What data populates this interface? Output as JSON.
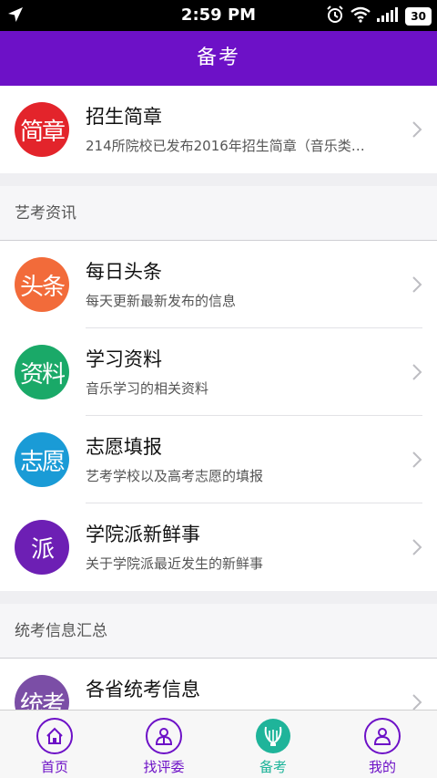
{
  "status_bar": {
    "time": "2:59 PM",
    "battery": "30",
    "icons": [
      "location-arrow-icon",
      "alarm-icon",
      "wifi-icon",
      "signal-icon",
      "battery-icon"
    ]
  },
  "nav": {
    "title": "备考"
  },
  "featured": {
    "title": "招生简章",
    "subtitle": "214所院校已发布2016年招生简章（音乐类…",
    "icon_text": "简章",
    "icon_color": "#e3242b"
  },
  "sections": [
    {
      "header": "艺考资讯",
      "items": [
        {
          "title": "每日头条",
          "subtitle": "每天更新最新发布的信息",
          "icon_text": "头条",
          "icon_color": "#f26b3a"
        },
        {
          "title": "学习资料",
          "subtitle": "音乐学习的相关资料",
          "icon_text": "资料",
          "icon_color": "#1aa968"
        },
        {
          "title": "志愿填报",
          "subtitle": "艺考学校以及高考志愿的填报",
          "icon_text": "志愿",
          "icon_color": "#1a9bd6"
        },
        {
          "title": "学院派新鲜事",
          "subtitle": "关于学院派最近发生的新鲜事",
          "icon_text": "派",
          "icon_color": "#6d1fb4"
        }
      ]
    },
    {
      "header": "统考信息汇总",
      "items": [
        {
          "title": "各省统考信息",
          "subtitle": "",
          "icon_text": "统考",
          "icon_color": "#7b4ea6"
        }
      ]
    }
  ],
  "tabs": [
    {
      "label": "首页",
      "icon": "home-icon"
    },
    {
      "label": "找评委",
      "icon": "judge-icon"
    },
    {
      "label": "备考",
      "icon": "lyre-icon",
      "active": true
    },
    {
      "label": "我的",
      "icon": "profile-icon"
    }
  ],
  "colors": {
    "primary": "#6d11c7",
    "active_tab": "#1fb49a"
  }
}
